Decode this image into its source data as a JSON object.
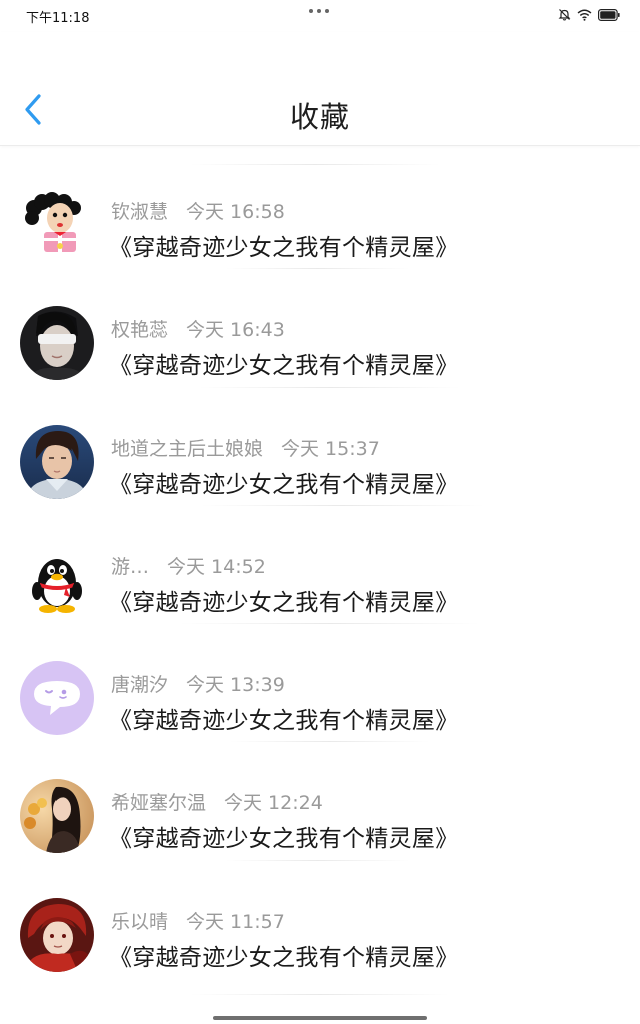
{
  "status_bar": {
    "time": "下午11:18",
    "icons": [
      "bell-off-icon",
      "wifi-icon",
      "battery-icon"
    ]
  },
  "header": {
    "title": "收藏",
    "back_icon": "chevron-left-icon",
    "accent_color": "#2f9bf0"
  },
  "favorites": [
    {
      "name": "钦淑慧",
      "time": "今天 16:58",
      "content": "《穿越奇迹少女之我有个精灵屋》",
      "avatar": "cartoon-girl-avatar"
    },
    {
      "name": "权艳蕊",
      "time": "今天 16:43",
      "content": "《穿越奇迹少女之我有个精灵屋》",
      "avatar": "blindfold-boy-avatar"
    },
    {
      "name": "地道之主后土娘娘",
      "time": "今天 15:37",
      "content": "《穿越奇迹少女之我有个精灵屋》",
      "avatar": "anime-man-avatar"
    },
    {
      "name": "游…",
      "time": "今天 14:52",
      "content": "《穿越奇迹少女之我有个精灵屋》",
      "avatar": "qq-penguin-avatar"
    },
    {
      "name": "唐潮汐",
      "time": "今天 13:39",
      "content": "《穿越奇迹少女之我有个精灵屋》",
      "avatar": "purple-chat-avatar"
    },
    {
      "name": "希娅塞尔温",
      "time": "今天 12:24",
      "content": "《穿越奇迹少女之我有个精灵屋》",
      "avatar": "flower-girl-avatar"
    },
    {
      "name": "乐以晴",
      "time": "今天 11:57",
      "content": "《穿越奇迹少女之我有个精灵屋》",
      "avatar": "red-hair-avatar"
    }
  ]
}
